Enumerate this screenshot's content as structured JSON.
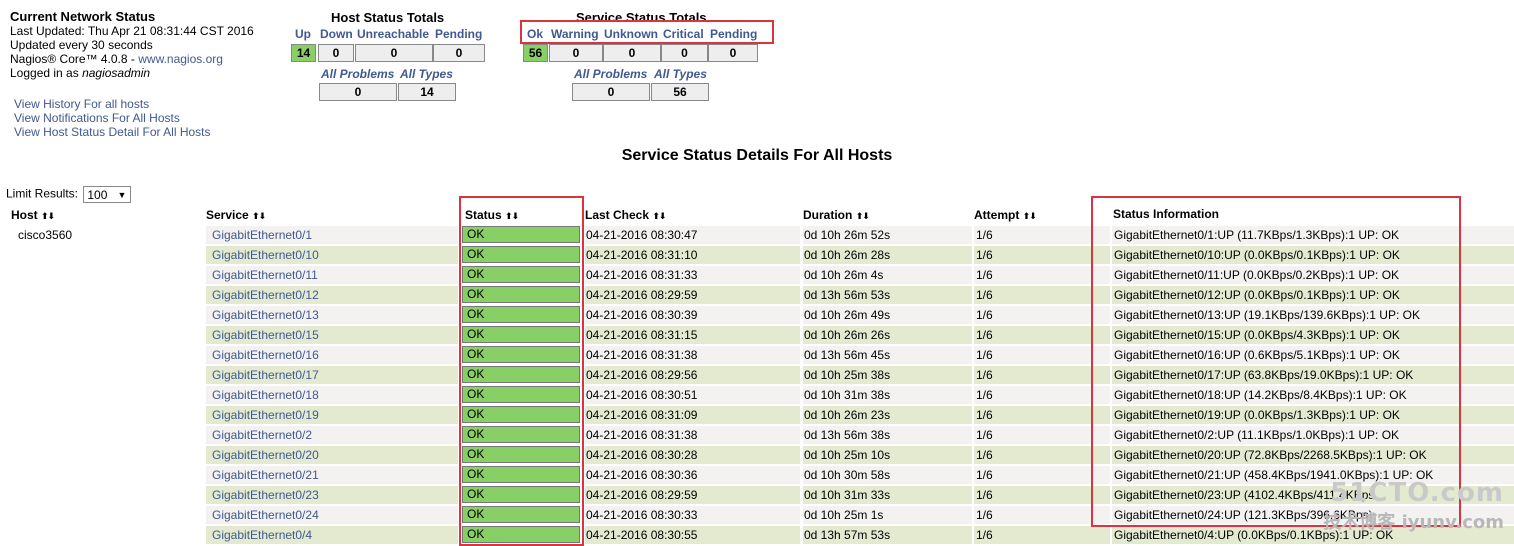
{
  "info": {
    "title": "Current Network Status",
    "last_updated": "Last Updated: Thu Apr 21 08:31:44 CST 2016",
    "update_interval": "Updated every 30 seconds",
    "version_prefix": "Nagios® Core™ 4.0.8 - ",
    "version_link": "www.nagios.org",
    "logged_in_prefix": "Logged in as ",
    "user": "nagiosadmin"
  },
  "links": [
    "View History For all hosts",
    "View Notifications For All Hosts",
    "View Host Status Detail For All Hosts"
  ],
  "host_totals": {
    "title": "Host Status Totals",
    "labels": [
      "Up",
      "Down",
      "Unreachable",
      "Pending"
    ],
    "values": [
      "14",
      "0",
      "0",
      "0"
    ],
    "problem_labels": [
      "All Problems",
      "All Types"
    ],
    "problem_values": [
      "0",
      "14"
    ]
  },
  "service_totals": {
    "title": "Service Status Totals",
    "labels": [
      "Ok",
      "Warning",
      "Unknown",
      "Critical",
      "Pending"
    ],
    "values": [
      "56",
      "0",
      "0",
      "0",
      "0"
    ],
    "problem_labels": [
      "All Problems",
      "All Types"
    ],
    "problem_values": [
      "0",
      "56"
    ]
  },
  "page_heading": "Service Status Details For All Hosts",
  "limit": {
    "label": "Limit Results:",
    "value": "100"
  },
  "table": {
    "headers": {
      "host": "Host",
      "service": "Service",
      "status": "Status",
      "last_check": "Last Check",
      "duration": "Duration",
      "attempt": "Attempt",
      "info": "Status Information"
    },
    "sort_glyph": "⬆⬇",
    "rows": [
      {
        "host": "cisco3560",
        "service": "GigabitEthernet0/1",
        "status": "OK",
        "last_check": "04-21-2016 08:30:47",
        "duration": "0d 10h 26m 52s",
        "attempt": "1/6",
        "info": "GigabitEthernet0/1:UP (11.7KBps/1.3KBps):1 UP: OK"
      },
      {
        "host": "",
        "service": "GigabitEthernet0/10",
        "status": "OK",
        "last_check": "04-21-2016 08:31:10",
        "duration": "0d 10h 26m 28s",
        "attempt": "1/6",
        "info": "GigabitEthernet0/10:UP (0.0KBps/0.1KBps):1 UP: OK"
      },
      {
        "host": "",
        "service": "GigabitEthernet0/11",
        "status": "OK",
        "last_check": "04-21-2016 08:31:33",
        "duration": "0d 10h 26m 4s",
        "attempt": "1/6",
        "info": "GigabitEthernet0/11:UP (0.0KBps/0.2KBps):1 UP: OK"
      },
      {
        "host": "",
        "service": "GigabitEthernet0/12",
        "status": "OK",
        "last_check": "04-21-2016 08:29:59",
        "duration": "0d 13h 56m 53s",
        "attempt": "1/6",
        "info": "GigabitEthernet0/12:UP (0.0KBps/0.1KBps):1 UP: OK"
      },
      {
        "host": "",
        "service": "GigabitEthernet0/13",
        "status": "OK",
        "last_check": "04-21-2016 08:30:39",
        "duration": "0d 10h 26m 49s",
        "attempt": "1/6",
        "info": "GigabitEthernet0/13:UP (19.1KBps/139.6KBps):1 UP: OK"
      },
      {
        "host": "",
        "service": "GigabitEthernet0/15",
        "status": "OK",
        "last_check": "04-21-2016 08:31:15",
        "duration": "0d 10h 26m 26s",
        "attempt": "1/6",
        "info": "GigabitEthernet0/15:UP (0.0KBps/4.3KBps):1 UP: OK"
      },
      {
        "host": "",
        "service": "GigabitEthernet0/16",
        "status": "OK",
        "last_check": "04-21-2016 08:31:38",
        "duration": "0d 13h 56m 45s",
        "attempt": "1/6",
        "info": "GigabitEthernet0/16:UP (0.6KBps/5.1KBps):1 UP: OK"
      },
      {
        "host": "",
        "service": "GigabitEthernet0/17",
        "status": "OK",
        "last_check": "04-21-2016 08:29:56",
        "duration": "0d 10h 25m 38s",
        "attempt": "1/6",
        "info": "GigabitEthernet0/17:UP (63.8KBps/19.0KBps):1 UP: OK"
      },
      {
        "host": "",
        "service": "GigabitEthernet0/18",
        "status": "OK",
        "last_check": "04-21-2016 08:30:51",
        "duration": "0d 10h 31m 38s",
        "attempt": "1/6",
        "info": "GigabitEthernet0/18:UP (14.2KBps/8.4KBps):1 UP: OK"
      },
      {
        "host": "",
        "service": "GigabitEthernet0/19",
        "status": "OK",
        "last_check": "04-21-2016 08:31:09",
        "duration": "0d 10h 26m 23s",
        "attempt": "1/6",
        "info": "GigabitEthernet0/19:UP (0.0KBps/1.3KBps):1 UP: OK"
      },
      {
        "host": "",
        "service": "GigabitEthernet0/2",
        "status": "OK",
        "last_check": "04-21-2016 08:31:38",
        "duration": "0d 13h 56m 38s",
        "attempt": "1/6",
        "info": "GigabitEthernet0/2:UP (11.1KBps/1.0KBps):1 UP: OK"
      },
      {
        "host": "",
        "service": "GigabitEthernet0/20",
        "status": "OK",
        "last_check": "04-21-2016 08:30:28",
        "duration": "0d 10h 25m 10s",
        "attempt": "1/6",
        "info": "GigabitEthernet0/20:UP (72.8KBps/2268.5KBps):1 UP: OK"
      },
      {
        "host": "",
        "service": "GigabitEthernet0/21",
        "status": "OK",
        "last_check": "04-21-2016 08:30:36",
        "duration": "0d 10h 30m 58s",
        "attempt": "1/6",
        "info": "GigabitEthernet0/21:UP (458.4KBps/1941.0KBps):1 UP: OK"
      },
      {
        "host": "",
        "service": "GigabitEthernet0/23",
        "status": "OK",
        "last_check": "04-21-2016 08:29:59",
        "duration": "0d 10h 31m 33s",
        "attempt": "1/6",
        "info": "GigabitEthernet0/23:UP (4102.4KBps/411.4KBps"
      },
      {
        "host": "",
        "service": "GigabitEthernet0/24",
        "status": "OK",
        "last_check": "04-21-2016 08:30:33",
        "duration": "0d 10h 25m 1s",
        "attempt": "1/6",
        "info": "GigabitEthernet0/24:UP (121.3KBps/396.6KBps)"
      },
      {
        "host": "",
        "service": "GigabitEthernet0/4",
        "status": "OK",
        "last_check": "04-21-2016 08:30:55",
        "duration": "0d 13h 57m 53s",
        "attempt": "1/6",
        "info": "GigabitEthernet0/4:UP (0.0KBps/0.1KBps):1 UP: OK"
      }
    ]
  },
  "watermark": {
    "line1": "51CTO.com",
    "line2": "技术博客 iyunv.com"
  },
  "colors": {
    "ok_green": "#88d066",
    "link": "#40598f",
    "highlight_red": "#d9343f",
    "row_even": "#e4ead0",
    "row_odd": "#f4f2f0"
  }
}
